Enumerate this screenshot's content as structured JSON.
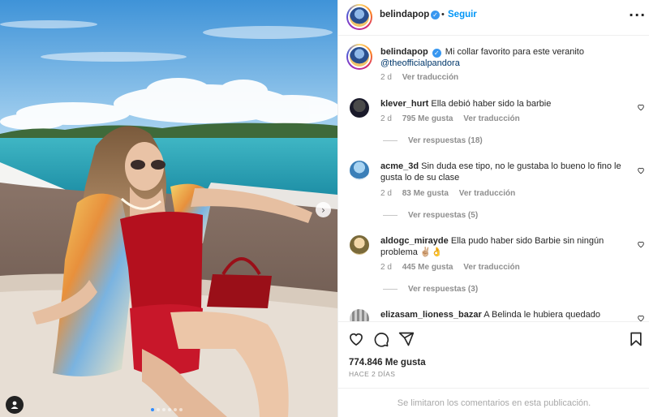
{
  "post": {
    "author": "belindapop",
    "follow_label": "Seguir",
    "separator": "•",
    "more_icon": "more-horizontal-icon"
  },
  "caption": {
    "username": "belindapop",
    "text": "Mi collar favorito para este veranito",
    "mention": "@theofficialpandora",
    "age": "2 d",
    "translate_label": "Ver traducción"
  },
  "comments": [
    {
      "username": "klever_hurt",
      "text": "Ella debió haber sido la barbie",
      "age": "2 d",
      "likes": "795 Me gusta",
      "translate_label": "Ver traducción",
      "replies_label": "Ver respuestas (18)"
    },
    {
      "username": "acme_3d",
      "text": "Sin duda ese tipo, no le gustaba lo bueno lo fino le gusta lo de su clase",
      "age": "2 d",
      "likes": "83 Me gusta",
      "translate_label": "Ver traducción",
      "replies_label": "Ver respuestas (5)"
    },
    {
      "username": "aldogc_miraydе",
      "text": "Ella pudo haber sido Barbie sin ningún problema ✌🏼👌",
      "age": "2 d",
      "likes": "445 Me gusta",
      "translate_label": "Ver traducción",
      "replies_label": "Ver respuestas (3)"
    },
    {
      "username": "elizasam_lioness_bazar",
      "text": "A Belinda le hubiera quedado",
      "age": "",
      "likes": "",
      "translate_label": "",
      "replies_label": ""
    }
  ],
  "actions": {
    "like_icon": "heart-icon",
    "comment_icon": "comment-icon",
    "share_icon": "share-icon",
    "save_icon": "bookmark-icon"
  },
  "stats": {
    "likes": "774.846 Me gusta",
    "posted": "HACE 2 DÍAS"
  },
  "footer": {
    "notice": "Se limitaron los comentarios en esta publicación."
  },
  "carousel": {
    "slide_count": 6,
    "active_index": 0
  },
  "colors": {
    "accent": "#0095f6",
    "verified": "#3897f0",
    "muted": "#8e8e8e"
  }
}
